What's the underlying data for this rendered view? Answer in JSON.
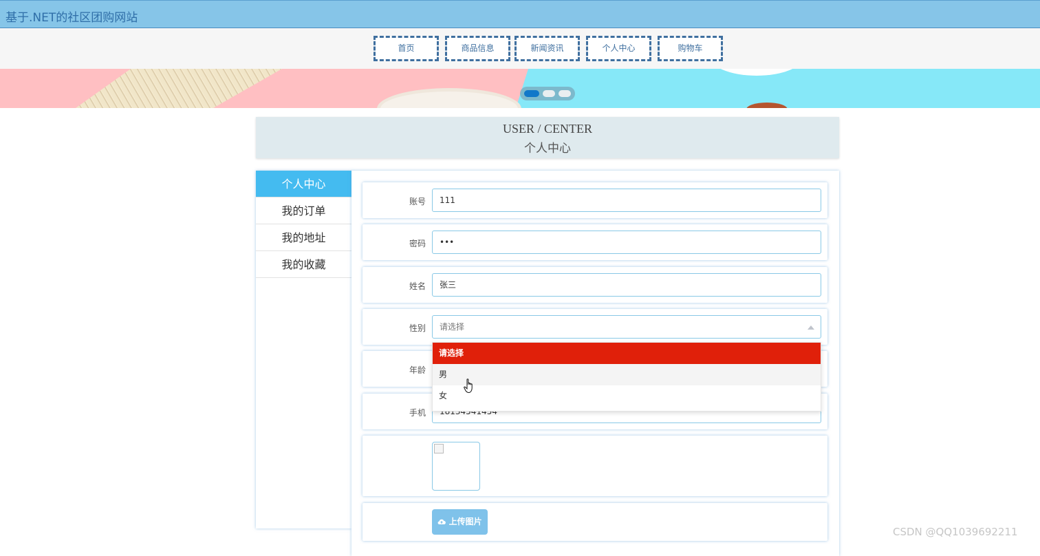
{
  "site": {
    "title": "基于.NET的社区团购网站"
  },
  "nav": {
    "items": [
      {
        "label": "首页"
      },
      {
        "label": "商品信息"
      },
      {
        "label": "新闻资讯"
      },
      {
        "label": "个人中心"
      },
      {
        "label": "购物车"
      }
    ]
  },
  "carousel": {
    "slide_count": 3,
    "active_index": 0,
    "active_color": "#1178c9"
  },
  "section": {
    "en_title": "USER / CENTER",
    "cn_title": "个人中心"
  },
  "sidebar": {
    "items": [
      {
        "label": "个人中心",
        "active": true
      },
      {
        "label": "我的订单"
      },
      {
        "label": "我的地址"
      },
      {
        "label": "我的收藏"
      }
    ]
  },
  "form": {
    "account": {
      "label": "账号",
      "value": "111"
    },
    "password": {
      "label": "密码",
      "value": "•••"
    },
    "name": {
      "label": "姓名",
      "value": "张三"
    },
    "gender": {
      "label": "性别",
      "placeholder": "请选择",
      "options": [
        "请选择",
        "男",
        "女"
      ],
      "selected": "请选择"
    },
    "age": {
      "label": "年龄"
    },
    "phone": {
      "label": "手机",
      "value": "18134541454"
    },
    "upload_label": "上传图片",
    "upload_icon": "cloud-upload-icon"
  },
  "colors": {
    "header": "#86c5e8",
    "sidebar_active": "#44bbf0",
    "option_selected": "#e0200a"
  },
  "watermark": "CSDN @QQ1039692211"
}
